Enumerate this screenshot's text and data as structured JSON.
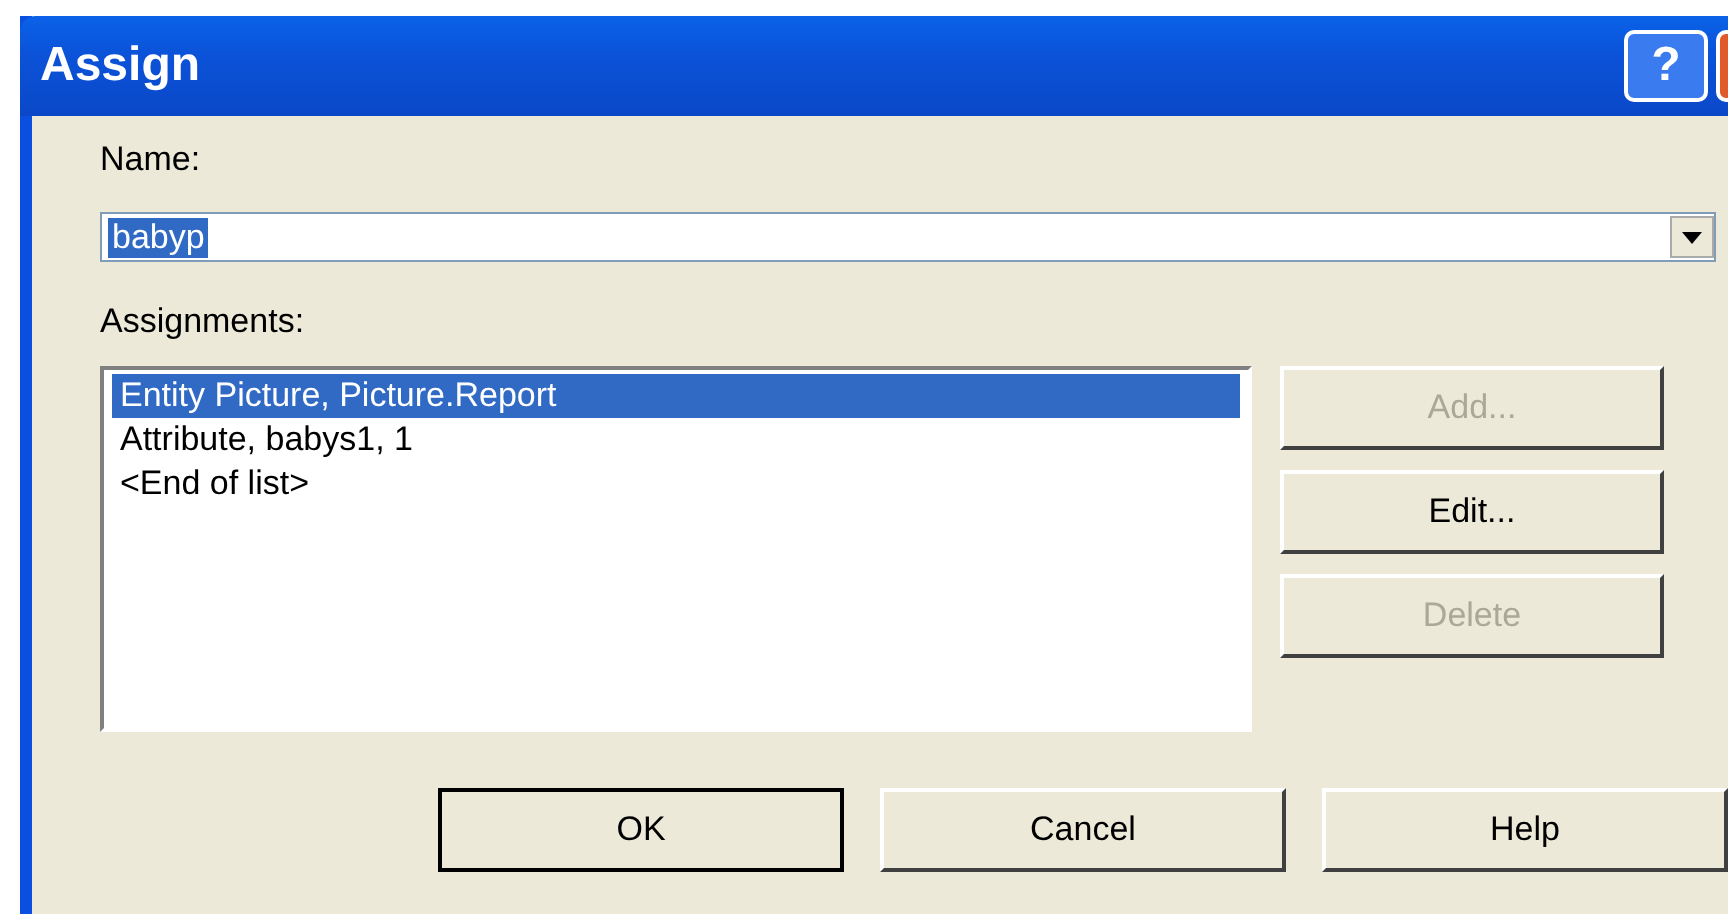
{
  "window": {
    "title": "Assign",
    "help_glyph": "?"
  },
  "name_field": {
    "label": "Name:",
    "value": "babyp",
    "value_selected": true
  },
  "assignments": {
    "label": "Assignments:",
    "items": [
      {
        "text": "Entity Picture, Picture.Report",
        "selected": true
      },
      {
        "text": "Attribute, babys1, 1",
        "selected": false
      },
      {
        "text": "<End of list>",
        "selected": false
      }
    ]
  },
  "side_buttons": [
    {
      "label": "Add...",
      "disabled": true
    },
    {
      "label": "Edit...",
      "disabled": false
    },
    {
      "label": "Delete",
      "disabled": true
    }
  ],
  "footer_buttons": [
    {
      "label": "OK",
      "default": true
    },
    {
      "label": "Cancel",
      "default": false
    },
    {
      "label": "Help",
      "default": false
    }
  ]
}
